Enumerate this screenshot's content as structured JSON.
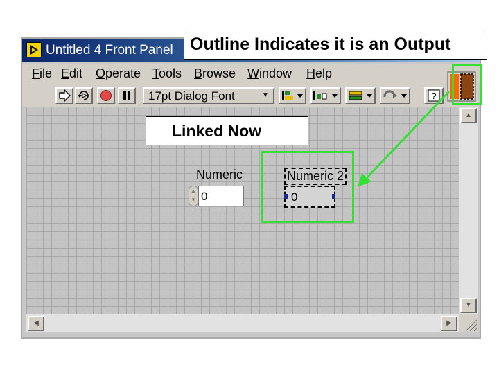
{
  "window": {
    "title": "Untitled 4 Front Panel"
  },
  "menu": [
    {
      "first": "F",
      "rest": "ile"
    },
    {
      "first": "E",
      "rest": "dit"
    },
    {
      "first": "O",
      "rest": "perate"
    },
    {
      "first": "T",
      "rest": "ools"
    },
    {
      "first": "B",
      "rest": "rowse"
    },
    {
      "first": "W",
      "rest": "indow"
    },
    {
      "first": "H",
      "rest": "elp"
    }
  ],
  "toolbar": {
    "font": "17pt Dialog Font",
    "buttons": [
      "run-icon",
      "run-continuously-icon",
      "abort-icon",
      "pause-icon",
      "align-icon",
      "distribute-icon",
      "resize-icon",
      "reorder-icon",
      "help-icon"
    ]
  },
  "controls": {
    "numeric": {
      "label": "Numeric",
      "value": "0"
    },
    "numeric2": {
      "label": "Numeric 2",
      "value": "0"
    }
  },
  "annotations": {
    "output_note": "Outline Indicates it is an Output",
    "linked_note": "Linked Now"
  },
  "colors": {
    "highlight": "#33e033",
    "indicator_orange": "#ff6600",
    "indicator_brown": "#8b4513"
  }
}
